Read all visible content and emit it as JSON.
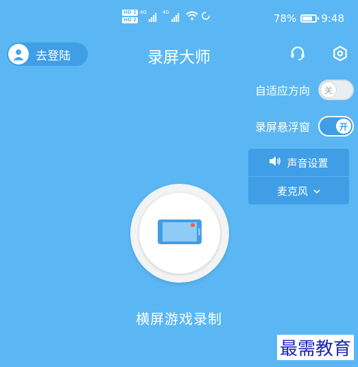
{
  "status_bar": {
    "hd1": "HD 1",
    "hd2": "HD 2",
    "net1": "4G",
    "net2": "4G",
    "battery_text": "78%",
    "battery_level": 0.78,
    "time": "9:48"
  },
  "header": {
    "login_label": "去登陆",
    "title": "录屏大师",
    "icons": [
      "headset-icon",
      "gear-icon"
    ]
  },
  "settings": {
    "orientation": {
      "label": "自适应方向",
      "state_text": "关",
      "on": false
    },
    "floating": {
      "label": "录屏悬浮窗",
      "state_text": "开",
      "on": true
    }
  },
  "sound_panel": {
    "title": "声音设置",
    "source": "麦克风"
  },
  "record": {
    "label": "横屏游戏录制"
  },
  "watermark": "最需教育",
  "colors": {
    "background": "#5ab7f4",
    "accent_dark": "#3f9ee6",
    "record_dot": "#ff5a3c",
    "watermark": "#1a22b8"
  }
}
